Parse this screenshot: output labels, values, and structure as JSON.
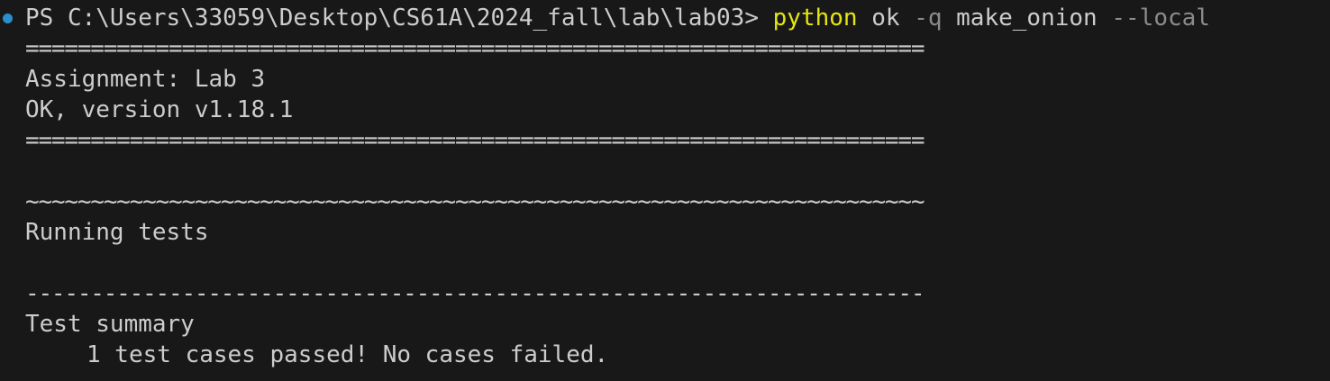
{
  "prompt": {
    "text": "PS C:\\Users\\33059\\Desktop\\CS61A\\2024_fall\\lab\\lab03> "
  },
  "command": {
    "program": "python",
    "script": "ok",
    "flag_q": "-q",
    "target": "make_onion",
    "flag_local": "--local"
  },
  "output": {
    "rule_equals": "=====================================================================",
    "assignment": "Assignment: Lab 3",
    "version": "OK, version v1.18.1",
    "rule_equals_2": "=====================================================================",
    "rule_tilde": "~~~~~~~~~~~~~~~~~~~~~~~~~~~~~~~~~~~~~~~~~~~~~~~~~~~~~~~~~~~~~~~~~~~~~",
    "running": "Running tests",
    "rule_dash": "---------------------------------------------------------------------",
    "summary_title": "Test summary",
    "summary_result": "1 test cases passed! No cases failed."
  },
  "colors": {
    "background": "#181818",
    "foreground": "#cccccc",
    "program": "#e5e510",
    "flag": "#8b8b8b",
    "decoration": "#2a8fcf"
  }
}
